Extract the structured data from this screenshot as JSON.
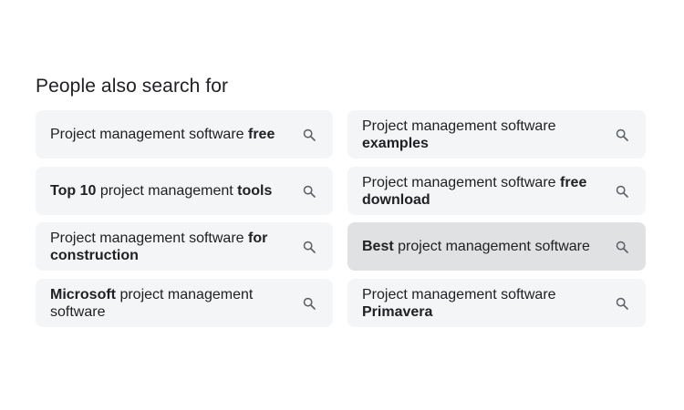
{
  "section": {
    "title": "People also search for"
  },
  "chips": [
    {
      "segments": [
        {
          "text": "Project management software ",
          "bold": false
        },
        {
          "text": "free",
          "bold": true
        }
      ],
      "icon": "search-icon"
    },
    {
      "segments": [
        {
          "text": "Project management software ",
          "bold": false
        },
        {
          "text": "examples",
          "bold": true
        }
      ],
      "icon": "search-icon"
    },
    {
      "segments": [
        {
          "text": "Top 10",
          "bold": true
        },
        {
          "text": " project management ",
          "bold": false
        },
        {
          "text": "tools",
          "bold": true
        }
      ],
      "icon": "search-icon"
    },
    {
      "segments": [
        {
          "text": "Project management software ",
          "bold": false
        },
        {
          "text": "free download",
          "bold": true
        }
      ],
      "icon": "search-icon"
    },
    {
      "segments": [
        {
          "text": "Project management software ",
          "bold": false
        },
        {
          "text": "for construction",
          "bold": true
        }
      ],
      "icon": "search-icon"
    },
    {
      "segments": [
        {
          "text": "Best",
          "bold": true
        },
        {
          "text": " project management software",
          "bold": false
        }
      ],
      "icon": "search-icon"
    },
    {
      "segments": [
        {
          "text": "Microsoft",
          "bold": true
        },
        {
          "text": " project management software",
          "bold": false
        }
      ],
      "icon": "search-icon"
    },
    {
      "segments": [
        {
          "text": "Project management software ",
          "bold": false
        },
        {
          "text": "Primavera",
          "bold": true
        }
      ],
      "icon": "search-icon"
    }
  ],
  "colors": {
    "chip_background": "#f4f5f6",
    "chip_hover_background": "#e0e1e2",
    "text": "#202124",
    "icon": "#5f6368"
  }
}
